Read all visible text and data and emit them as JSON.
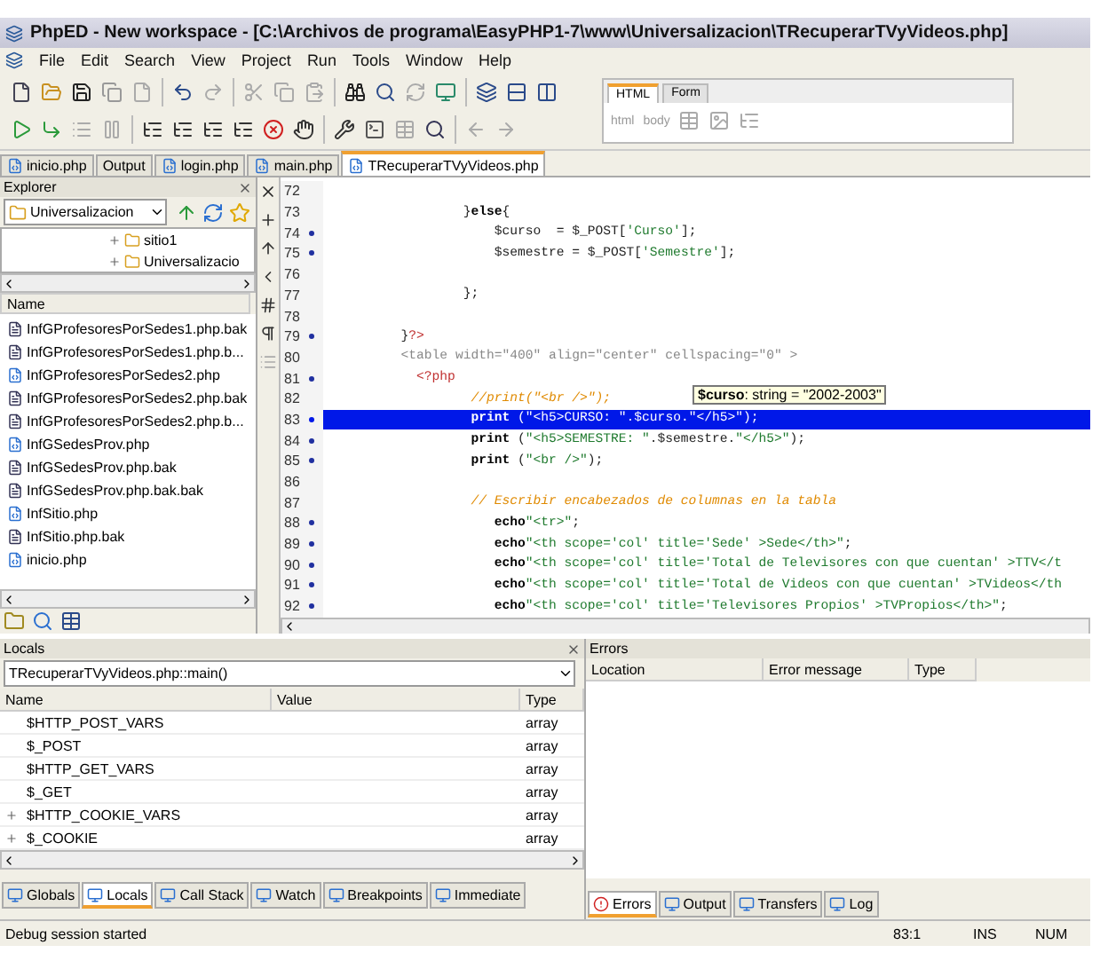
{
  "window": {
    "title": "PhpED - New workspace - [C:\\Archivos de programa\\EasyPHP1-7\\www\\Universalizacion\\TRecuperarTVyVideos.php]"
  },
  "menu": [
    "File",
    "Edit",
    "Search",
    "View",
    "Project",
    "Run",
    "Tools",
    "Window",
    "Help"
  ],
  "html_panel": {
    "tabs": [
      {
        "label": "HTML",
        "selected": true
      },
      {
        "label": "Form",
        "selected": false
      }
    ],
    "path": [
      "html",
      "body"
    ]
  },
  "editor_tabs": [
    {
      "label": "inicio.php",
      "selected": false,
      "kind": "file"
    },
    {
      "label": "Output",
      "selected": false,
      "kind": "plain"
    },
    {
      "label": "login.php",
      "selected": false,
      "kind": "file"
    },
    {
      "label": "main.php",
      "selected": false,
      "kind": "file"
    },
    {
      "label": "TRecuperarTVyVideos.php",
      "selected": true,
      "kind": "file"
    }
  ],
  "explorer": {
    "title": "Explorer",
    "folder": "Universalizacion",
    "tree": [
      {
        "label": "sitio1"
      },
      {
        "label": "Universalizacio"
      }
    ],
    "column": "Name",
    "files": [
      {
        "name": "InfGProfesoresPorSedes1.php.bak",
        "kind": "bak"
      },
      {
        "name": "InfGProfesoresPorSedes1.php.b...",
        "kind": "bak"
      },
      {
        "name": "InfGProfesoresPorSedes2.php",
        "kind": "php"
      },
      {
        "name": "InfGProfesoresPorSedes2.php.bak",
        "kind": "bak"
      },
      {
        "name": "InfGProfesoresPorSedes2.php.b...",
        "kind": "bak"
      },
      {
        "name": "InfGSedesProv.php",
        "kind": "php"
      },
      {
        "name": "InfGSedesProv.php.bak",
        "kind": "bak"
      },
      {
        "name": "InfGSedesProv.php.bak.bak",
        "kind": "bak"
      },
      {
        "name": "InfSitio.php",
        "kind": "php"
      },
      {
        "name": "InfSitio.php.bak",
        "kind": "bak"
      },
      {
        "name": "inicio.php",
        "kind": "php"
      }
    ]
  },
  "code": {
    "lines": [
      {
        "number": "72",
        "breakpoint": false,
        "current": false
      },
      {
        "number": "73",
        "breakpoint": false,
        "current": false,
        "tokens": [
          {
            "kind": "plain",
            "text": "                  }"
          },
          {
            "kind": "keyword",
            "text": "else"
          },
          {
            "kind": "plain",
            "text": "{"
          }
        ]
      },
      {
        "number": "74",
        "breakpoint": true,
        "current": false,
        "tokens": [
          {
            "kind": "plain",
            "text": "                      $curso  = $_POST["
          },
          {
            "kind": "string",
            "text": "'Curso'"
          },
          {
            "kind": "plain",
            "text": "];"
          }
        ]
      },
      {
        "number": "75",
        "breakpoint": true,
        "current": false,
        "tokens": [
          {
            "kind": "plain",
            "text": "                      $semestre = $_POST["
          },
          {
            "kind": "string",
            "text": "'Semestre'"
          },
          {
            "kind": "plain",
            "text": "];"
          }
        ]
      },
      {
        "number": "76",
        "breakpoint": false,
        "current": false
      },
      {
        "number": "77",
        "breakpoint": false,
        "current": false,
        "tokens": [
          {
            "kind": "plain",
            "text": "                  };"
          }
        ]
      },
      {
        "number": "78",
        "breakpoint": false,
        "current": false
      },
      {
        "number": "79",
        "breakpoint": true,
        "current": false,
        "tokens": [
          {
            "kind": "plain",
            "text": "          }"
          },
          {
            "kind": "tag",
            "text": "?>"
          }
        ]
      },
      {
        "number": "80",
        "breakpoint": false,
        "current": false,
        "tokens": [
          {
            "kind": "html",
            "text": "          <table width=\"400\" align=\"center\" cellspacing=\"0\" >"
          }
        ]
      },
      {
        "number": "81",
        "breakpoint": true,
        "current": false,
        "tokens": [
          {
            "kind": "tag",
            "text": "            <?php"
          }
        ]
      },
      {
        "number": "82",
        "breakpoint": false,
        "current": false,
        "tokens": [
          {
            "kind": "comment",
            "text": "                   //print(\"<br />\");"
          }
        ]
      },
      {
        "number": "83",
        "breakpoint": true,
        "current": true,
        "tokens": [
          {
            "kind": "keyword",
            "text": "                   print"
          },
          {
            "kind": "plain",
            "text": " ("
          },
          {
            "kind": "string",
            "text": "\"<h5>CURSO: \""
          },
          {
            "kind": "plain",
            "text": ".$curso."
          },
          {
            "kind": "string",
            "text": "\"</h5>\""
          },
          {
            "kind": "plain",
            "text": ");"
          }
        ]
      },
      {
        "number": "84",
        "breakpoint": true,
        "current": false,
        "tokens": [
          {
            "kind": "keyword",
            "text": "                   print"
          },
          {
            "kind": "plain",
            "text": " ("
          },
          {
            "kind": "string",
            "text": "\"<h5>SEMESTRE: \""
          },
          {
            "kind": "plain",
            "text": ".$semestre."
          },
          {
            "kind": "string",
            "text": "\"</h5>\""
          },
          {
            "kind": "plain",
            "text": ");"
          }
        ]
      },
      {
        "number": "85",
        "breakpoint": true,
        "current": false,
        "tokens": [
          {
            "kind": "keyword",
            "text": "                   print"
          },
          {
            "kind": "plain",
            "text": " ("
          },
          {
            "kind": "string",
            "text": "\"<br />\""
          },
          {
            "kind": "plain",
            "text": ");"
          }
        ]
      },
      {
        "number": "86",
        "breakpoint": false,
        "current": false
      },
      {
        "number": "87",
        "breakpoint": false,
        "current": false,
        "tokens": [
          {
            "kind": "comment",
            "text": "                   // Escribir encabezados de columnas en la tabla"
          }
        ]
      },
      {
        "number": "88",
        "breakpoint": true,
        "current": false,
        "tokens": [
          {
            "kind": "keyword",
            "text": "                      echo"
          },
          {
            "kind": "string",
            "text": "\"<tr>\""
          },
          {
            "kind": "plain",
            "text": ";"
          }
        ]
      },
      {
        "number": "89",
        "breakpoint": true,
        "current": false,
        "tokens": [
          {
            "kind": "keyword",
            "text": "                      echo"
          },
          {
            "kind": "string",
            "text": "\"<th scope='col' title='Sede' >Sede</th>\""
          },
          {
            "kind": "plain",
            "text": ";"
          }
        ]
      },
      {
        "number": "90",
        "breakpoint": true,
        "current": false,
        "tokens": [
          {
            "kind": "keyword",
            "text": "                      echo"
          },
          {
            "kind": "string",
            "text": "\"<th scope='col' title='Total de Televisores con que cuentan' >TTV</t"
          }
        ]
      },
      {
        "number": "91",
        "breakpoint": true,
        "current": false,
        "tokens": [
          {
            "kind": "keyword",
            "text": "                      echo"
          },
          {
            "kind": "string",
            "text": "\"<th scope='col' title='Total de Videos con que cuentan' >TVideos</th"
          }
        ]
      },
      {
        "number": "92",
        "breakpoint": true,
        "current": false,
        "tokens": [
          {
            "kind": "keyword",
            "text": "                      echo"
          },
          {
            "kind": "string",
            "text": "\"<th scope='col' title='Televisores Propios' >TVPropios</th>\""
          },
          {
            "kind": "plain",
            "text": ";"
          }
        ]
      }
    ],
    "tooltip": "**$curso**: string = \"2002-2003\""
  },
  "locals": {
    "title": "Locals",
    "scope": "TRecuperarTVyVideos.php::main()",
    "columns": [
      "Name",
      "Value",
      "Type"
    ],
    "rows": [
      {
        "name": "$HTTP_POST_VARS",
        "type": "array",
        "expandable": false
      },
      {
        "name": "$_POST",
        "type": "array",
        "expandable": false
      },
      {
        "name": "$HTTP_GET_VARS",
        "type": "array",
        "expandable": false
      },
      {
        "name": "$_GET",
        "type": "array",
        "expandable": false
      },
      {
        "name": "$HTTP_COOKIE_VARS",
        "type": "array",
        "expandable": true
      },
      {
        "name": "$_COOKIE",
        "type": "array",
        "expandable": true
      }
    ],
    "tabs": [
      {
        "label": "Globals",
        "selected": false
      },
      {
        "label": "Locals",
        "selected": true
      },
      {
        "label": "Call Stack",
        "selected": false
      },
      {
        "label": "Watch",
        "selected": false
      },
      {
        "label": "Breakpoints",
        "selected": false
      },
      {
        "label": "Immediate",
        "selected": false
      }
    ]
  },
  "errors": {
    "title": "Errors",
    "columns": [
      "Location",
      "Error message",
      "Type"
    ],
    "tabs": [
      {
        "label": "Errors",
        "selected": true
      },
      {
        "label": "Output",
        "selected": false
      },
      {
        "label": "Transfers",
        "selected": false
      },
      {
        "label": "Log",
        "selected": false
      }
    ]
  },
  "status_bar": {
    "message": "Debug session started",
    "position": "83:1",
    "mode": "INS",
    "num": "NUM"
  }
}
